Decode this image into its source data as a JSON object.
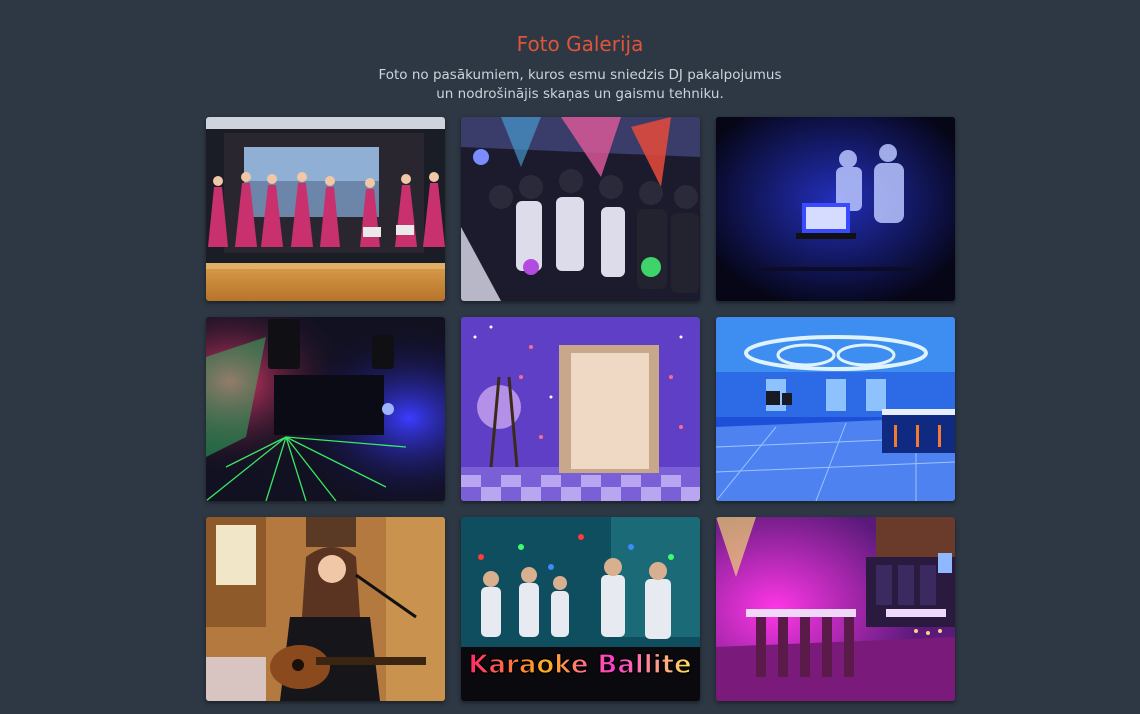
{
  "header": {
    "title": "Foto Galerija",
    "subtitle_line1": "Foto no pasākumiem, kuros esmu sniedzis DJ pakalpojumus",
    "subtitle_line2": "un nodrošinājis skaņas un gaismu tehniku."
  },
  "gallery": {
    "items": [
      {
        "name": "photo-choir-stage"
      },
      {
        "name": "photo-dance-party"
      },
      {
        "name": "photo-dj-laptop-dark"
      },
      {
        "name": "photo-speakers-lasers"
      },
      {
        "name": "photo-doorway-lights"
      },
      {
        "name": "photo-blue-hall"
      },
      {
        "name": "photo-guitar-singer"
      },
      {
        "name": "photo-karaoke",
        "caption": "Karaoke Ballite"
      },
      {
        "name": "photo-purple-restaurant"
      }
    ]
  },
  "colors": {
    "background": "#2d3844",
    "title": "#e0543a",
    "subtitle": "#ccd3da"
  }
}
